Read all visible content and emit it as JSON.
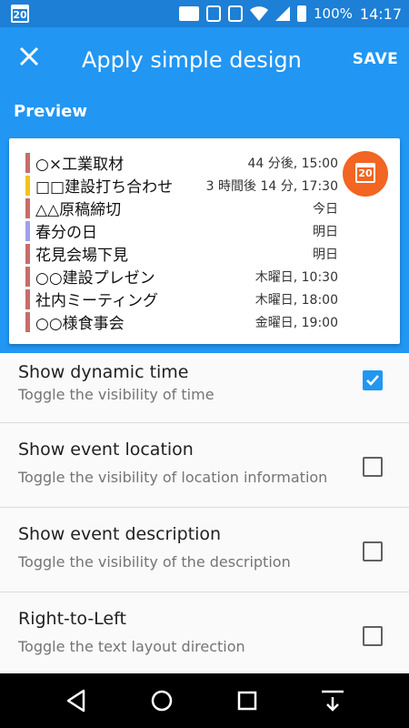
{
  "status_bar": {
    "calendar_day": "20",
    "battery_text": "100%",
    "time": "14:17"
  },
  "app_bar": {
    "close_icon": "close-icon",
    "title": "Apply simple design",
    "save_label": "SAVE"
  },
  "preview": {
    "label": "Preview",
    "fab_calendar_day": "20",
    "events": [
      {
        "title": "○×工業取材",
        "time": "44 分後, 15:00",
        "color": "#c96b6b"
      },
      {
        "title": "□□建設打ち合わせ",
        "time": "3 時間後 14 分, 17:30",
        "color": "#f4c21b"
      },
      {
        "title": "△△原稿締切",
        "time": "今日",
        "color": "#c96b6b"
      },
      {
        "title": "春分の日",
        "time": "明日",
        "color": "#a0a0f0"
      },
      {
        "title": "花見会場下見",
        "time": "明日",
        "color": "#c96b6b"
      },
      {
        "title": "○○建設プレゼン",
        "time": "木曜日, 10:30",
        "color": "#c96b6b"
      },
      {
        "title": "社内ミーティング",
        "time": "木曜日, 18:00",
        "color": "#c96b6b"
      },
      {
        "title": "○○様食事会",
        "time": "金曜日, 19:00",
        "color": "#c96b6b"
      }
    ]
  },
  "settings": [
    {
      "title": "Show dynamic time",
      "subtitle": "Toggle the visibility of time",
      "checked": true
    },
    {
      "title": "Show event location",
      "subtitle": "Toggle the visibility of location information",
      "checked": false
    },
    {
      "title": "Show event description",
      "subtitle": "Toggle the visibility of the description",
      "checked": false
    },
    {
      "title": "Right-to-Left",
      "subtitle": "Toggle the text layout direction",
      "checked": false
    }
  ],
  "colors": {
    "primary": "#2196f3",
    "status_bar": "#1d7fd6",
    "fab": "#f26522"
  }
}
